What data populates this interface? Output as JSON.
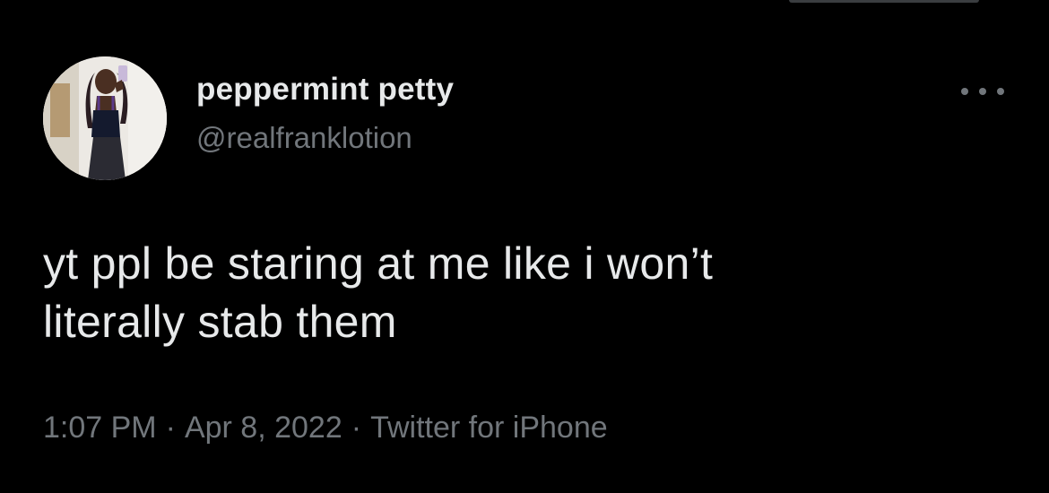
{
  "tweet": {
    "author": {
      "display_name": "peppermint petty",
      "handle": "@realfranklotion",
      "avatar_icon": "user-avatar-photo"
    },
    "more_icon": "more-options-icon",
    "text_line1": "yt ppl be staring at me like i won’t",
    "text_line2": "literally stab them",
    "meta": {
      "time": "1:07 PM",
      "separator": "·",
      "date": "Apr 8, 2022",
      "source": "Twitter for iPhone"
    }
  },
  "colors": {
    "background": "#000000",
    "primary_text": "#e7e9ea",
    "secondary_text": "#71767b"
  }
}
